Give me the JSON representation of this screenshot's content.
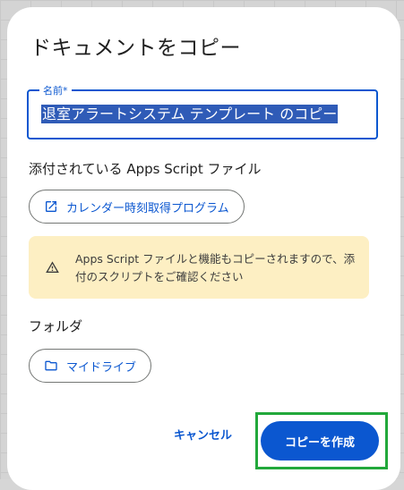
{
  "dialog": {
    "title": "ドキュメントをコピー",
    "name_field": {
      "label": "名前*",
      "value": "退室アラートシステム テンプレート のコピー"
    },
    "attached_section": {
      "label": "添付されている Apps Script ファイル",
      "chip_label": "カレンダー時刻取得プログラム",
      "chip_icon": "open-in-new-icon"
    },
    "warning": {
      "icon": "warning-icon",
      "text": "Apps Script ファイルと機能もコピーされますので、添付のスクリプトをご確認ください"
    },
    "folder_section": {
      "label": "フォルダ",
      "chip_label": "マイドライブ",
      "chip_icon": "folder-icon"
    },
    "actions": {
      "cancel_label": "キャンセル",
      "primary_label": "コピーを作成"
    }
  },
  "colors": {
    "accent": "#0b57d0",
    "warning_bg": "#fdefc3",
    "highlight": "#22a83b"
  }
}
